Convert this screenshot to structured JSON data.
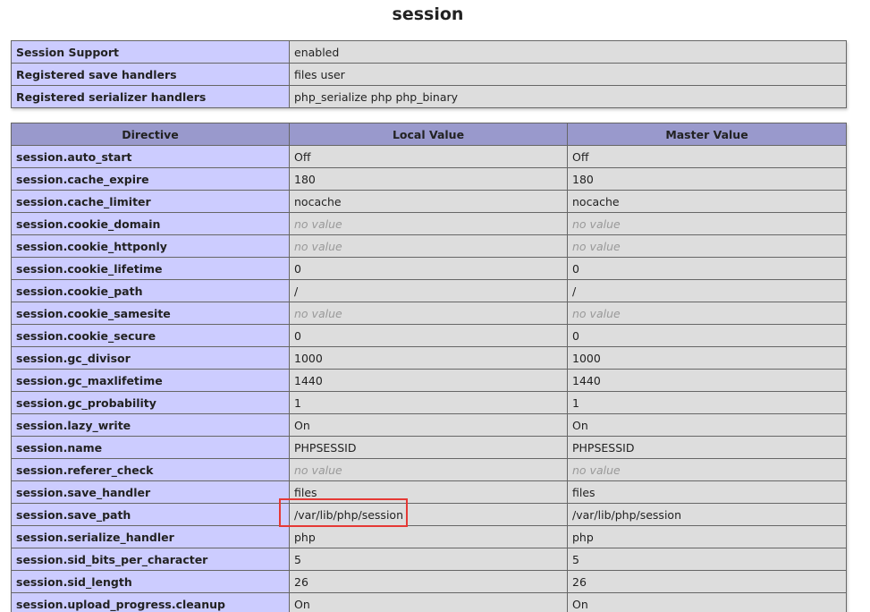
{
  "section": {
    "title": "session"
  },
  "info_rows": [
    {
      "label": "Session Support",
      "value": "enabled"
    },
    {
      "label": "Registered save handlers",
      "value": "files user"
    },
    {
      "label": "Registered serializer handlers",
      "value": "php_serialize php php_binary"
    }
  ],
  "directive_table": {
    "headers": [
      "Directive",
      "Local Value",
      "Master Value"
    ],
    "rows": [
      {
        "name": "session.auto_start",
        "local": "Off",
        "master": "Off"
      },
      {
        "name": "session.cache_expire",
        "local": "180",
        "master": "180"
      },
      {
        "name": "session.cache_limiter",
        "local": "nocache",
        "master": "nocache"
      },
      {
        "name": "session.cookie_domain",
        "local": "no value",
        "master": "no value",
        "novalue": true
      },
      {
        "name": "session.cookie_httponly",
        "local": "no value",
        "master": "no value",
        "novalue": true
      },
      {
        "name": "session.cookie_lifetime",
        "local": "0",
        "master": "0"
      },
      {
        "name": "session.cookie_path",
        "local": "/",
        "master": "/"
      },
      {
        "name": "session.cookie_samesite",
        "local": "no value",
        "master": "no value",
        "novalue": true
      },
      {
        "name": "session.cookie_secure",
        "local": "0",
        "master": "0"
      },
      {
        "name": "session.gc_divisor",
        "local": "1000",
        "master": "1000"
      },
      {
        "name": "session.gc_maxlifetime",
        "local": "1440",
        "master": "1440"
      },
      {
        "name": "session.gc_probability",
        "local": "1",
        "master": "1"
      },
      {
        "name": "session.lazy_write",
        "local": "On",
        "master": "On"
      },
      {
        "name": "session.name",
        "local": "PHPSESSID",
        "master": "PHPSESSID"
      },
      {
        "name": "session.referer_check",
        "local": "no value",
        "master": "no value",
        "novalue": true
      },
      {
        "name": "session.save_handler",
        "local": "files",
        "master": "files"
      },
      {
        "name": "session.save_path",
        "local": "/var/lib/php/session",
        "master": "/var/lib/php/session",
        "highlighted": true
      },
      {
        "name": "session.serialize_handler",
        "local": "php",
        "master": "php"
      },
      {
        "name": "session.sid_bits_per_character",
        "local": "5",
        "master": "5"
      },
      {
        "name": "session.sid_length",
        "local": "26",
        "master": "26"
      },
      {
        "name": "session.upload_progress.cleanup",
        "local": "On",
        "master": "On"
      }
    ]
  },
  "colors": {
    "label_cell": "#ccccff",
    "value_cell": "#dddddd",
    "header_cell": "#9999cc",
    "no_value_text": "#999999",
    "highlight_border": "#e53935"
  }
}
